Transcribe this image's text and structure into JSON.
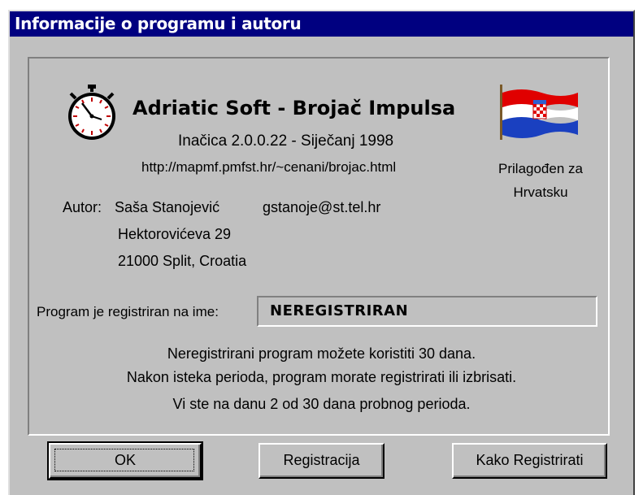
{
  "window": {
    "title": "Informacije o programu i autoru"
  },
  "about": {
    "app_title": "Adriatic Soft - Brojač Impulsa",
    "version": "Inačica 2.0.0.22  - Siječanj 1998",
    "url": "http://mapmf.pmfst.hr/~cenani/brojac.html",
    "adapted": "Prilagođen za Hrvatsku",
    "clock_icon": "stopwatch-icon",
    "flag_icon": "croatian-flag-icon"
  },
  "author": {
    "label": "Autor:",
    "name": "Saša Stanojević",
    "email": "gstanoje@st.tel.hr",
    "street": "Hektorovićeva 29",
    "city": "21000 Split, Croatia"
  },
  "registration": {
    "label": "Program je registriran na ime:",
    "value": "NEREGISTRIRAN",
    "msg1": "Neregistrirani program možete koristiti 30 dana.",
    "msg2": "Nakon isteka perioda, program morate registrirati ili izbrisati.",
    "msg3": "Vi ste na danu 2 od 30 dana probnog perioda."
  },
  "buttons": {
    "ok": "OK",
    "register": "Registracija",
    "how_to_register": "Kako Registrirati"
  },
  "colors": {
    "titlebar": "#000080",
    "face": "#c0c0c0"
  }
}
